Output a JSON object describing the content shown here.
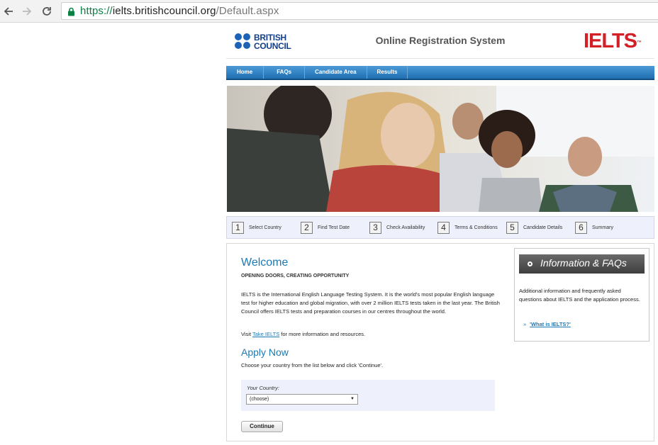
{
  "browser": {
    "url_protocol": "https://",
    "url_host": "ielts.britishcouncil.org",
    "url_path": "/Default.aspx"
  },
  "header": {
    "bc_logo_line1": "BRITISH",
    "bc_logo_line2": "COUNCIL",
    "title": "Online Registration System",
    "ielts_logo": "IELTS",
    "ielts_tm": "™"
  },
  "nav": {
    "items": [
      "Home",
      "FAQs",
      "Candidate Area",
      "Results"
    ]
  },
  "steps": [
    {
      "num": "1",
      "label": "Select Country"
    },
    {
      "num": "2",
      "label": "Find Test Date"
    },
    {
      "num": "3",
      "label": "Check Availability"
    },
    {
      "num": "4",
      "label": "Terms & Conditions"
    },
    {
      "num": "5",
      "label": "Candidate Details"
    },
    {
      "num": "6",
      "label": "Summary"
    }
  ],
  "main": {
    "welcome_heading": "Welcome",
    "tagline": "OPENING DOORS, CREATING OPPORTUNITY",
    "intro": "IELTS is the International English Language Testing System. It is the world's most popular English language test for higher education and global migration, with over 2 million IELTS tests taken in the last year. The British Council offers IELTS tests and preparation courses in our centres throughout the world.",
    "visit_prefix": "Visit ",
    "visit_link": "Take IELTS",
    "visit_suffix": " for more information and resources.",
    "apply_heading": "Apply Now",
    "apply_instructions": "Choose your country from the list below and click 'Continue'.",
    "country_label": "Your Country:",
    "country_selected": "(choose)",
    "continue_label": "Continue"
  },
  "sidebar": {
    "title": "Information & FAQs",
    "text": "Additional information and frequently asked questions about IELTS and the application process.",
    "link_marker": "»",
    "link_label": "'What is IELTS?'"
  },
  "colors": {
    "accent_blue": "#1d79b3",
    "nav_blue": "#2f80c3",
    "ielts_red": "#d32027",
    "bc_blue": "#1c63b7"
  }
}
